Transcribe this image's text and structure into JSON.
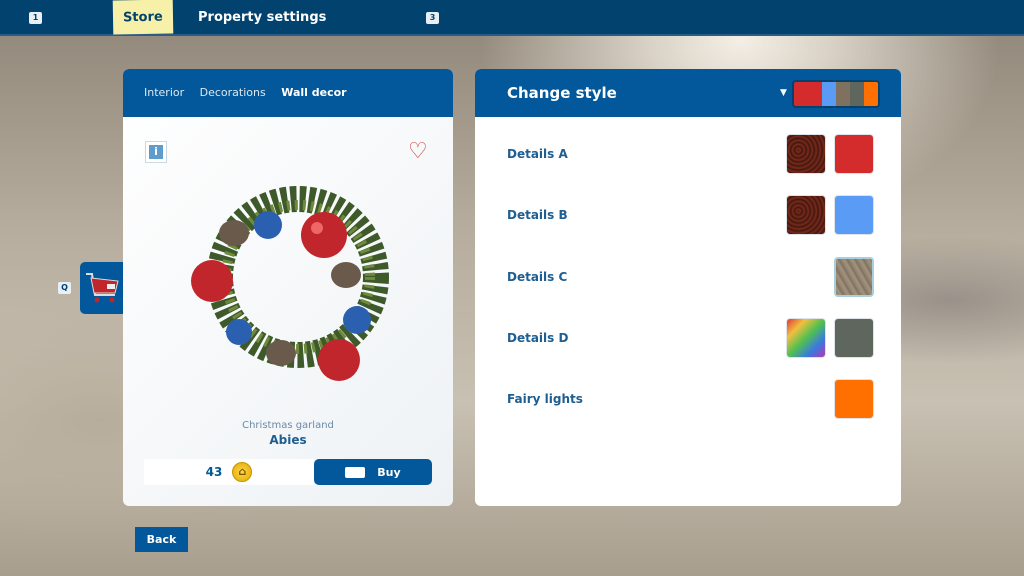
{
  "topbar": {
    "key_left": "1",
    "tabs": [
      {
        "label": "Store",
        "active": true
      },
      {
        "label": "Property settings",
        "active": false
      }
    ],
    "key_right": "3"
  },
  "product": {
    "breadcrumb": [
      "Interior",
      "Decorations",
      "Wall decor"
    ],
    "category": "Christmas garland",
    "name": "Abies",
    "price": "43",
    "buy_label": "Buy",
    "info_icon": "i"
  },
  "side": {
    "cart_key": "Q"
  },
  "back_label": "Back",
  "style_panel": {
    "title": "Change style",
    "palette": [
      "#d42c2c",
      "#5a9cf5",
      "#7f7060",
      "#5e665e",
      "#ff7000"
    ],
    "rows": [
      {
        "label": "Details A",
        "swatches": [
          "rust",
          "#d42c2c"
        ]
      },
      {
        "label": "Details B",
        "swatches": [
          "rust",
          "#5a9cf5"
        ]
      },
      {
        "label": "Details C",
        "swatches": [
          "wood"
        ]
      },
      {
        "label": "Details D",
        "swatches": [
          "rainbow",
          "#5e665e"
        ]
      },
      {
        "label": "Fairy lights",
        "swatches": [
          "#ff7000"
        ]
      }
    ]
  },
  "colors": {
    "brand": "#02589a",
    "topbar": "#01426f",
    "active_tab": "#f6f0a8"
  }
}
